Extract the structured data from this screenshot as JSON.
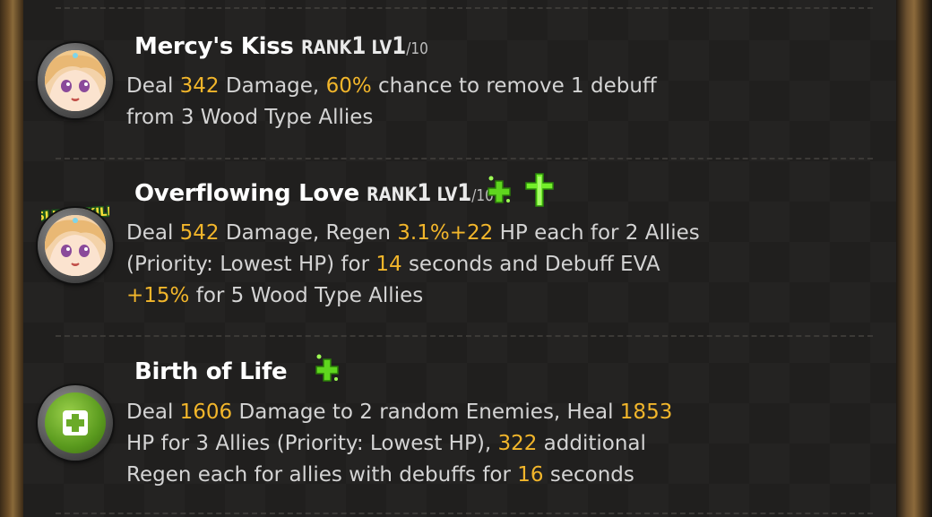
{
  "skills": [
    {
      "name": "Mercy's Kiss",
      "rank_label": "RANK",
      "rank": "1",
      "lv_label": "LV",
      "level": "1",
      "max_level": "/10",
      "desc_parts": [
        "Deal ",
        "342",
        " Damage, ",
        "60%",
        " chance to remove 1 debuff",
        "from 3 Wood Type Allies"
      ]
    },
    {
      "name": "Overflowing Love",
      "rank_label": "RANK",
      "rank": "1",
      "lv_label": "LV",
      "level": "1",
      "max_level": "/10",
      "badge": "SLIDE SKILL",
      "buff_icons": [
        "regen-plus-icon",
        "holy-cross-icon"
      ],
      "desc_parts": [
        "Deal ",
        "542",
        " Damage, Regen ",
        "3.1%+22",
        " HP each for 2 Allies",
        "(Priority: Lowest HP) for ",
        "14",
        " seconds and Debuff EVA",
        "+15%",
        " for 5 Wood Type Allies"
      ]
    },
    {
      "name": "Birth of Life",
      "buff_icons": [
        "regen-plus-icon"
      ],
      "desc_parts": [
        "Deal ",
        "1606",
        " Damage to 2 random Enemies, Heal ",
        "1853",
        "HP for 3 Allies (Priority: Lowest HP), ",
        "322",
        " additional",
        "Regen each for allies with debuffs for ",
        "16",
        " seconds"
      ]
    }
  ],
  "colors": {
    "highlight": "#f2b62b",
    "text": "#d4d4d4",
    "title": "#ffffff",
    "buff_green": "#7cff2a"
  }
}
